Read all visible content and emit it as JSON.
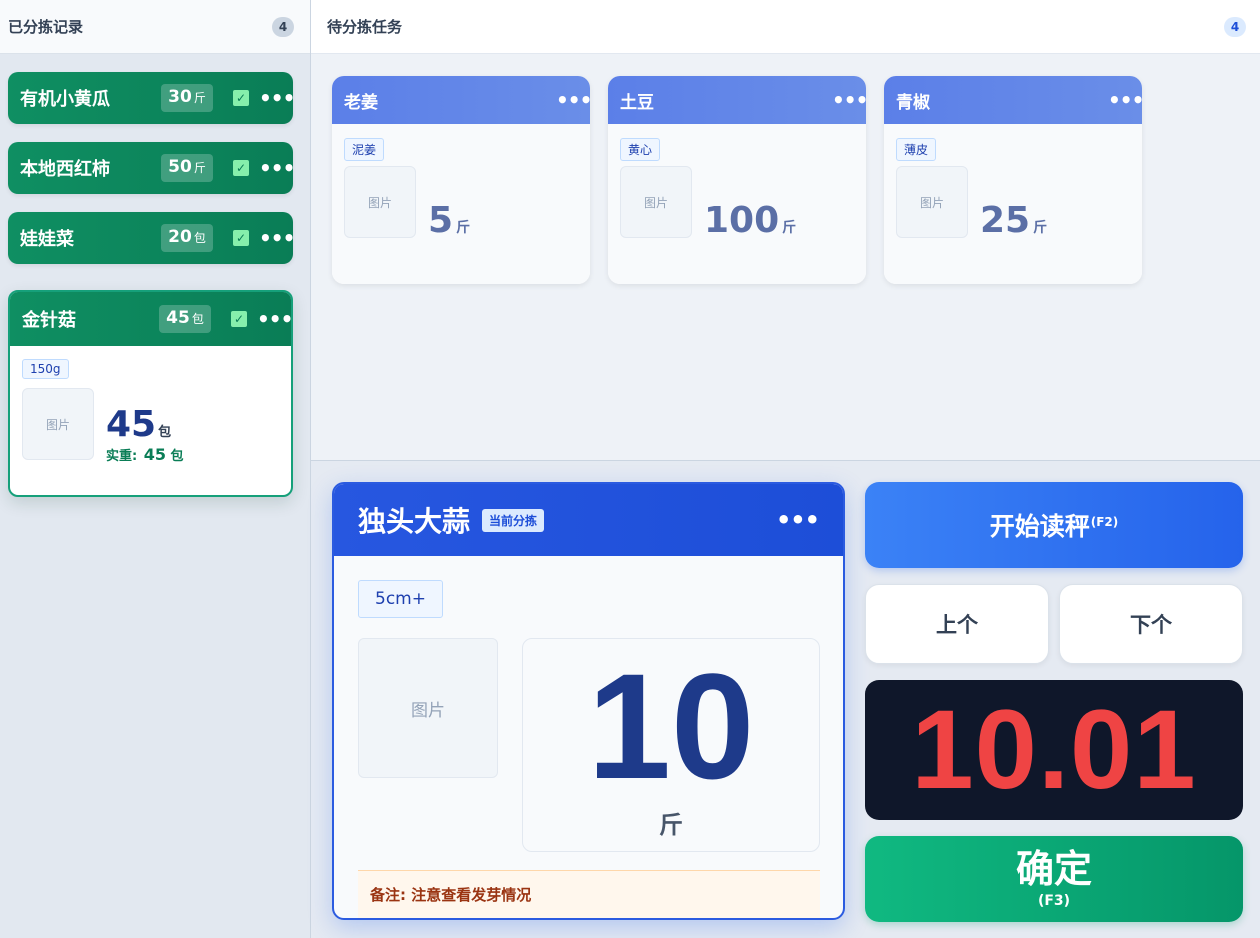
{
  "done_panel": {
    "title": "已分拣记录",
    "count": "4",
    "items": [
      {
        "name": "有机小黄瓜",
        "qty": "30",
        "unit": "斤"
      },
      {
        "name": "本地西红柿",
        "qty": "50",
        "unit": "斤"
      },
      {
        "name": "娃娃菜",
        "qty": "20",
        "unit": "包"
      }
    ],
    "expanded": {
      "name": "金针菇",
      "qty": "45",
      "unit": "包",
      "spec": "150g",
      "image_label": "图片",
      "big_qty": "45",
      "big_unit": "包",
      "actual_label": "实重:",
      "actual_value": "45",
      "actual_unit": "包"
    },
    "check_icon": "check-icon",
    "more_icon": "more-icon"
  },
  "pending_panel": {
    "title": "待分拣任务",
    "count": "4",
    "tasks": [
      {
        "name": "老姜",
        "spec": "泥姜",
        "qty": "5",
        "unit": "斤",
        "image_label": "图片"
      },
      {
        "name": "土豆",
        "spec": "黄心",
        "qty": "100",
        "unit": "斤",
        "image_label": "图片"
      },
      {
        "name": "青椒",
        "spec": "薄皮",
        "qty": "25",
        "unit": "斤",
        "image_label": "图片"
      }
    ]
  },
  "current": {
    "name": "独头大蒜",
    "badge": "当前分拣",
    "spec": "5cm+",
    "image_label": "图片",
    "qty": "10",
    "unit": "斤",
    "note": "备注: 注意查看发芽情况"
  },
  "controls": {
    "start_label": "开始读秤",
    "start_key": "(F2)",
    "prev_label": "上个",
    "next_label": "下个",
    "scale_value": "10.01",
    "confirm_label": "确定",
    "confirm_key": "(F3)"
  },
  "colors": {
    "done_green": "#0f8f62",
    "task_blue": "#5b7fe8",
    "current_blue": "#1d4ed8",
    "scale_red": "#ef4444",
    "scale_bg": "#0f172a",
    "confirm_green": "#10b981"
  }
}
